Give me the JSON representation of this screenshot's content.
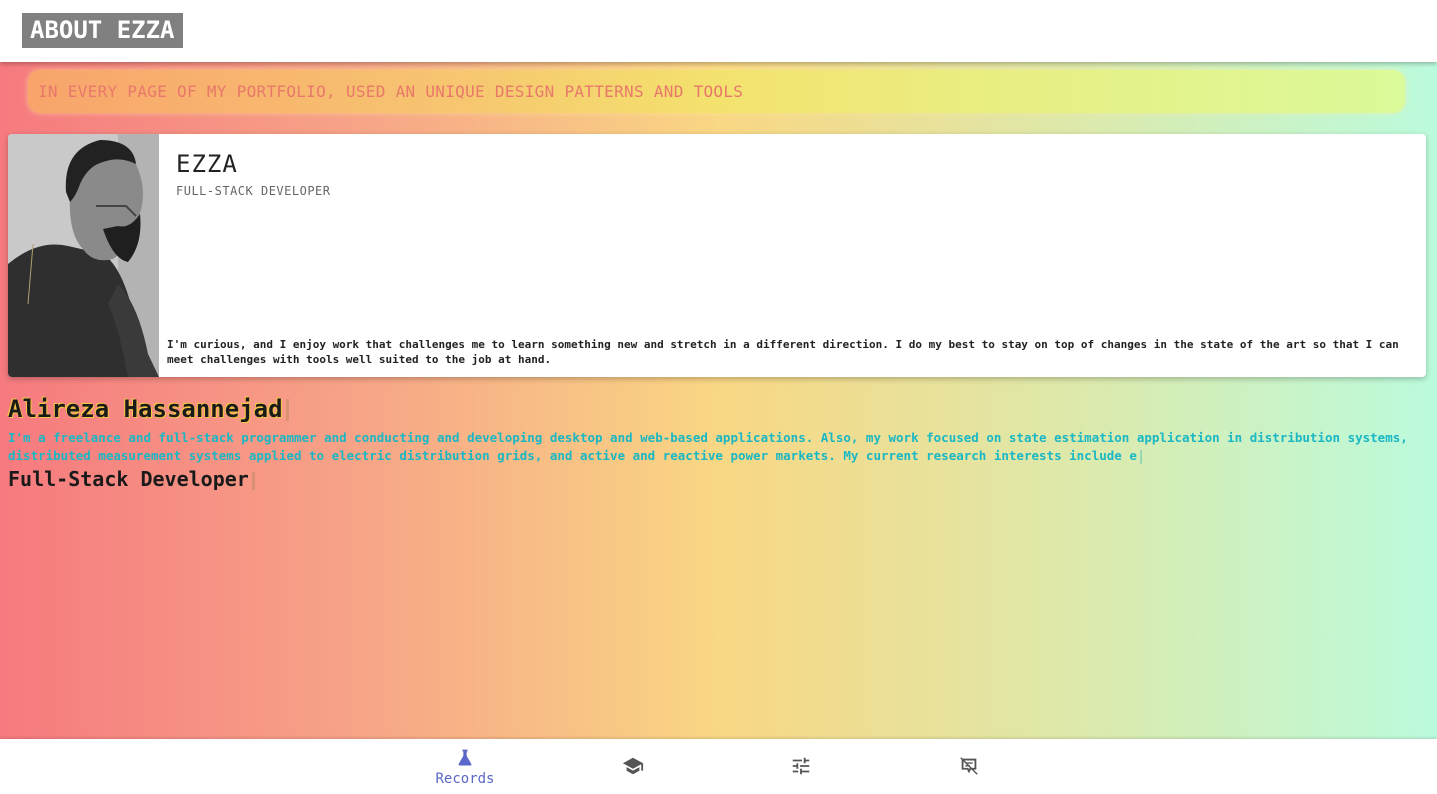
{
  "header": {
    "brand": "ABOUT EZZA"
  },
  "banner": {
    "text": "IN EVERY PAGE OF MY PORTFOLIO, USED AN UNIQUE DESIGN PATTERNS AND TOOLS"
  },
  "profile_card": {
    "name": "EZZA",
    "role": "FULL-STACK DEVELOPER",
    "description": "I'm curious, and I enjoy work that challenges me to learn something new and stretch in a different direction. I do my best to stay on top of changes in the state of the art so that I can meet challenges with tools well suited to the job at hand."
  },
  "hero": {
    "name": "Alireza Hassannejad",
    "bio": "I'm a freelance and full-stack programmer and conducting and developing desktop and web-based applications. Also, my work focused on state estimation application in distribution systems, distributed measurement systems applied to electric distribution grids, and active and reactive power markets. My current research interests include e",
    "role": "Full-Stack Developer"
  },
  "bottom_nav": {
    "items": [
      {
        "label": "Records",
        "icon": "flask-icon",
        "active": true
      },
      {
        "label": "",
        "icon": "graduation-cap-icon",
        "active": false
      },
      {
        "label": "",
        "icon": "sliders-icon",
        "active": false
      },
      {
        "label": "",
        "icon": "certificate-icon",
        "active": false
      }
    ]
  },
  "colors": {
    "accent": "#5a67c8",
    "banner_text": "#e8786a",
    "bio_text": "#1ab7c4",
    "brand_bg": "#808080"
  }
}
